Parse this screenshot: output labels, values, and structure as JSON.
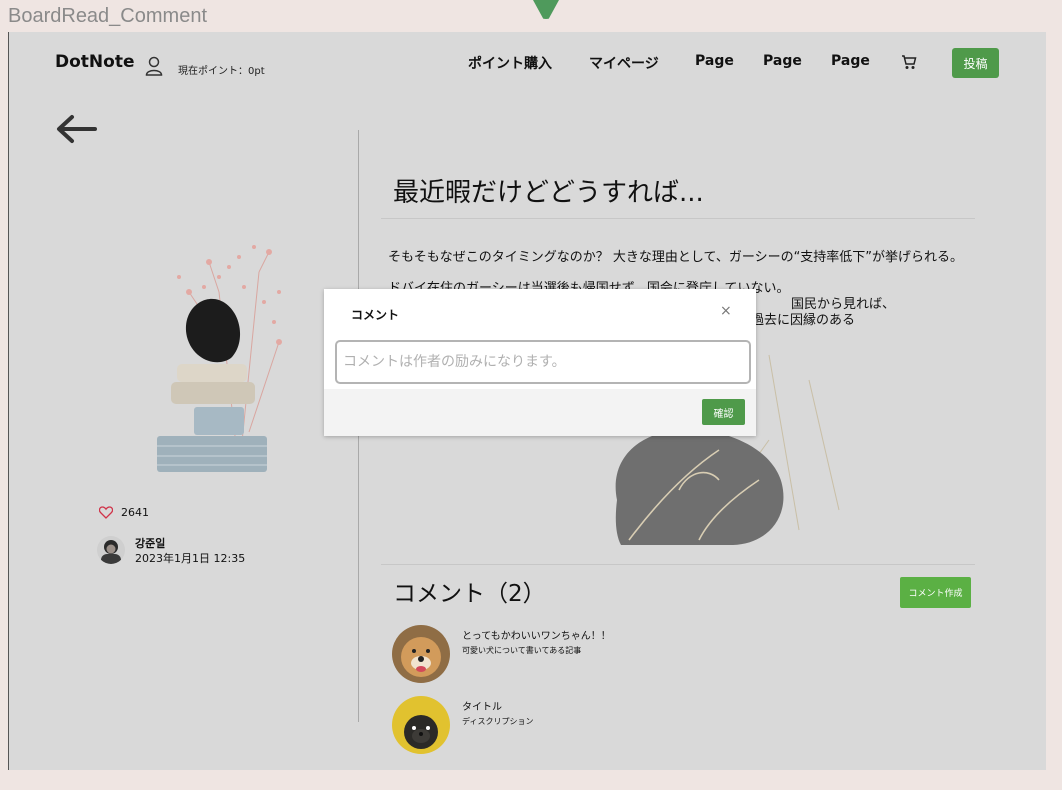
{
  "frame": {
    "label": "BoardRead_Comment"
  },
  "header": {
    "logo": "DotNote",
    "points_label": "現在ポイント：0pt",
    "nav": [
      "ポイント購入",
      "マイページ",
      "Page",
      "Page",
      "Page"
    ],
    "post_button": "投稿"
  },
  "post": {
    "likes": "2641",
    "author": "강준일",
    "date": "2023年1月1日 12:35",
    "title": "最近暇だけどどうすれば...",
    "paragraph1": "そもそもなぜこのタイミングなのか？ 大きな理由として、ガーシーの“支持率低下”が挙げられる。",
    "paragraph2_lines": [
      "ドバイ在住のガーシーは当選後も帰国せず、国会に登庁していない。",
      "国民から見れば、",
      "過去に因縁のある"
    ]
  },
  "comments": {
    "title": "コメント（2）",
    "write_button": "コメント作成",
    "items": [
      {
        "name": "とってもかわいいワンちゃん！！",
        "desc": "可愛い犬について書いてある記事",
        "avatar_color": "#c9884a"
      },
      {
        "name": "タイトル",
        "desc": "ディスクリプション",
        "avatar_color": "#e1c22f"
      }
    ]
  },
  "modal": {
    "title": "コメント",
    "close": "×",
    "input_placeholder": "コメントは作者の励みになります。",
    "input_value": "",
    "confirm_button": "確認"
  },
  "colors": {
    "accent": "#4f9a4a",
    "write_button": "#5bb044",
    "screen_bg": "#d9d9d9",
    "page_bg": "#efe5e2"
  }
}
